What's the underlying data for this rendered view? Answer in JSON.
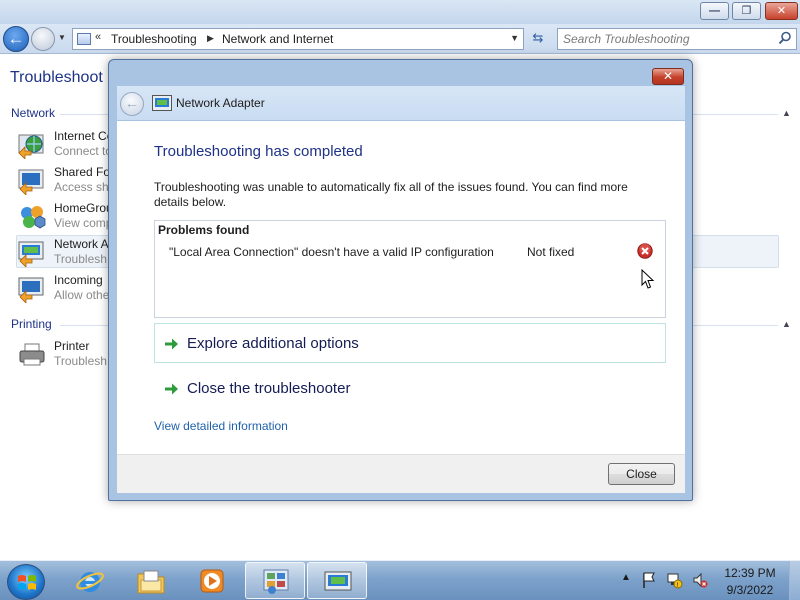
{
  "explorer": {
    "address": {
      "chevron": "«",
      "crumbs": [
        "Troubleshooting",
        "Network and Internet"
      ]
    },
    "search_placeholder": "Search Troubleshooting",
    "page_title": "Troubleshoot p",
    "sections": [
      {
        "label": "Network"
      },
      {
        "label": "Printing"
      }
    ],
    "items": [
      {
        "name": "Internet Co",
        "desc": "Connect to"
      },
      {
        "name": "Shared Fol",
        "desc": "Access sha"
      },
      {
        "name": "HomeGrou",
        "desc": "View comp"
      },
      {
        "name": "Network A",
        "desc": "Troublesh"
      },
      {
        "name": "Incoming",
        "desc": "Allow othe"
      },
      {
        "name": "Printer",
        "desc": "Troublesh"
      }
    ]
  },
  "dialog": {
    "header_title": "Network Adapter",
    "heading": "Troubleshooting has completed",
    "message": "Troubleshooting was unable to automatically fix all of the issues found. You can find more details below.",
    "problems_title": "Problems found",
    "problems": [
      {
        "description": "\"Local Area Connection\" doesn't have a valid IP configuration",
        "status": "Not fixed",
        "status_icon": "error-icon"
      }
    ],
    "commands": [
      {
        "label": "Explore additional options"
      },
      {
        "label": "Close the troubleshooter"
      }
    ],
    "detail_link": "View detailed information",
    "close_button": "Close"
  },
  "taskbar": {
    "time": "12:39 PM",
    "date": "9/3/2022",
    "apps": [
      "internet-explorer-icon",
      "windows-explorer-icon",
      "media-player-icon",
      "control-panel-icon",
      "network-adapter-icon"
    ]
  },
  "colors": {
    "heading": "#1e3287",
    "link": "#1f62ab",
    "accent_arrow": "#2e9b3c",
    "error": "#c9302c"
  }
}
